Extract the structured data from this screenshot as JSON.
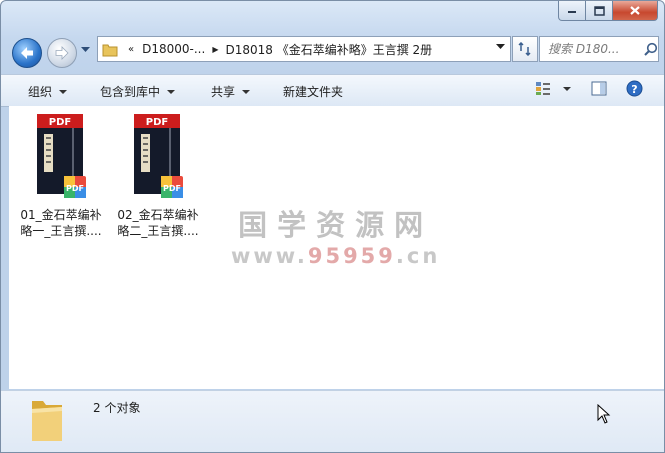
{
  "window": {
    "minimize_icon": "minimize-icon",
    "maximize_icon": "maximize-icon",
    "close_icon": "close-icon"
  },
  "nav": {
    "back_icon": "back-arrow-icon",
    "forward_icon": "forward-arrow-icon",
    "breadcrumb_overflow": "«",
    "breadcrumb": [
      "D18000-...",
      "D18018 《金石萃编补略》王言撰 2册"
    ],
    "search_placeholder": "搜索 D180...",
    "refresh_icon": "refresh-icon"
  },
  "toolbar": {
    "organize": "组织",
    "include_in_library": "包含到库中",
    "share": "共享",
    "new_folder": "新建文件夹",
    "view_icon": "view-options-icon",
    "preview_icon": "preview-pane-icon",
    "help_icon": "help-icon"
  },
  "files": [
    {
      "name": "01_金石萃编补略一_王言撰....",
      "badge": "PDF",
      "icon": "pdf-file-icon"
    },
    {
      "name": "02_金石萃编补略二_王言撰....",
      "badge": "PDF",
      "icon": "pdf-file-icon"
    }
  ],
  "watermark": {
    "title": "国学资源网",
    "url_prefix": "www.",
    "url_number": "95959",
    "url_suffix": ".cn"
  },
  "status": {
    "count": "2 个对象",
    "icon": "folder-icon"
  },
  "colors": {
    "pdf_red": "#cc1d1d",
    "window_frame": "#c4d7ee",
    "watermark": "#c2c2c2"
  }
}
